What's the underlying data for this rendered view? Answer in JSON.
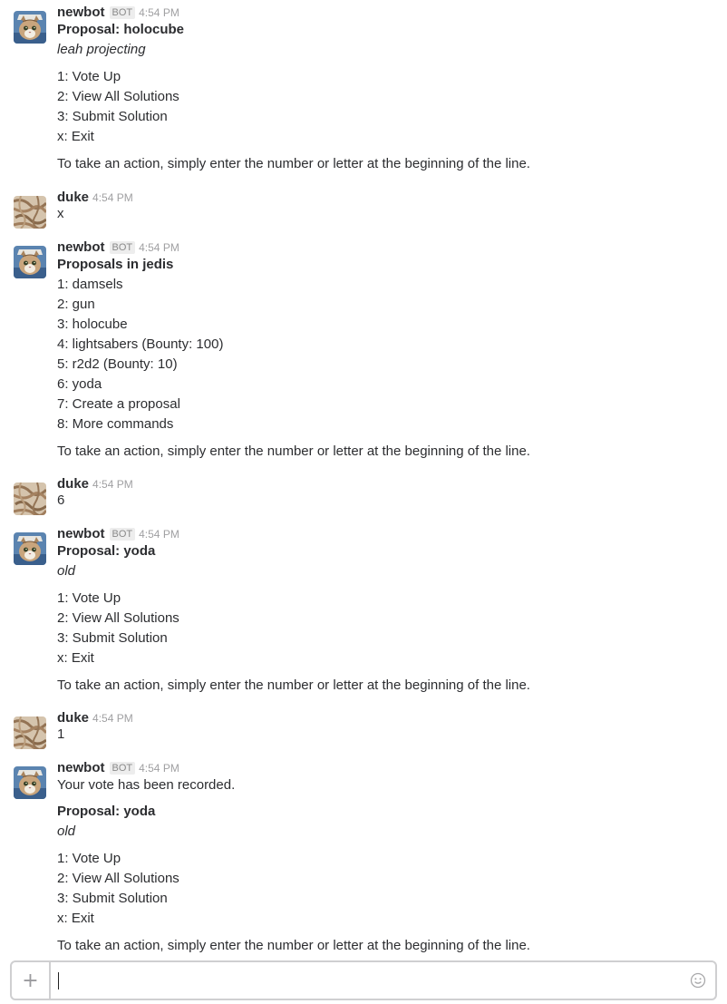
{
  "app": {
    "accent": "#2c2d30",
    "muted": "#a0a0a2"
  },
  "messages": [
    {
      "sender": "newbot",
      "bot": "BOT",
      "time": "4:54 PM",
      "avatar": "cat-avatar-icon",
      "lines": [
        {
          "text": "Proposal: holocube",
          "style": "bold"
        },
        {
          "text": "leah projecting",
          "style": "italic"
        },
        {
          "text": "1: Vote Up"
        },
        {
          "text": "2: View All Solutions"
        },
        {
          "text": "3: Submit Solution"
        },
        {
          "text": "x: Exit"
        },
        {
          "text": "To take an action, simply enter the number or letter at the beginning of the line."
        }
      ]
    },
    {
      "sender": "duke",
      "bot": "",
      "time": "4:54 PM",
      "avatar": "rope-avatar-icon",
      "lines": [
        {
          "text": "x"
        }
      ]
    },
    {
      "sender": "newbot",
      "bot": "BOT",
      "time": "4:54 PM",
      "avatar": "cat-avatar-icon",
      "lines": [
        {
          "text": "Proposals in jedis",
          "style": "bold"
        },
        {
          "text": "1: damsels"
        },
        {
          "text": "2: gun"
        },
        {
          "text": "3: holocube"
        },
        {
          "text": "4: lightsabers (Bounty: 100)"
        },
        {
          "text": "5: r2d2 (Bounty: 10)"
        },
        {
          "text": "6: yoda"
        },
        {
          "text": "7: Create a proposal"
        },
        {
          "text": "8: More commands"
        },
        {
          "text": "To take an action, simply enter the number or letter at the beginning of the line."
        }
      ]
    },
    {
      "sender": "duke",
      "bot": "",
      "time": "4:54 PM",
      "avatar": "rope-avatar-icon",
      "lines": [
        {
          "text": "6"
        }
      ]
    },
    {
      "sender": "newbot",
      "bot": "BOT",
      "time": "4:54 PM",
      "avatar": "cat-avatar-icon",
      "lines": [
        {
          "text": "Proposal: yoda",
          "style": "bold"
        },
        {
          "text": "old",
          "style": "italic"
        },
        {
          "text": "1: Vote Up"
        },
        {
          "text": "2: View All Solutions"
        },
        {
          "text": "3: Submit Solution"
        },
        {
          "text": "x: Exit"
        },
        {
          "text": "To take an action, simply enter the number or letter at the beginning of the line."
        }
      ]
    },
    {
      "sender": "duke",
      "bot": "",
      "time": "4:54 PM",
      "avatar": "rope-avatar-icon",
      "lines": [
        {
          "text": "1"
        }
      ]
    },
    {
      "sender": "newbot",
      "bot": "BOT",
      "time": "4:54 PM",
      "avatar": "cat-avatar-icon",
      "lines": [
        {
          "text": "Your vote has been recorded."
        },
        {
          "text": "Proposal: yoda",
          "style": "bold"
        },
        {
          "text": "old",
          "style": "italic"
        },
        {
          "text": "1: Vote Up"
        },
        {
          "text": "2: View All Solutions"
        },
        {
          "text": "3: Submit Solution"
        },
        {
          "text": "x: Exit"
        },
        {
          "text": "To take an action, simply enter the number or letter at the beginning of the line."
        }
      ]
    }
  ],
  "composer": {
    "add_icon": "plus-icon",
    "emoji_icon": "smiley-icon",
    "value": "",
    "placeholder": ""
  }
}
